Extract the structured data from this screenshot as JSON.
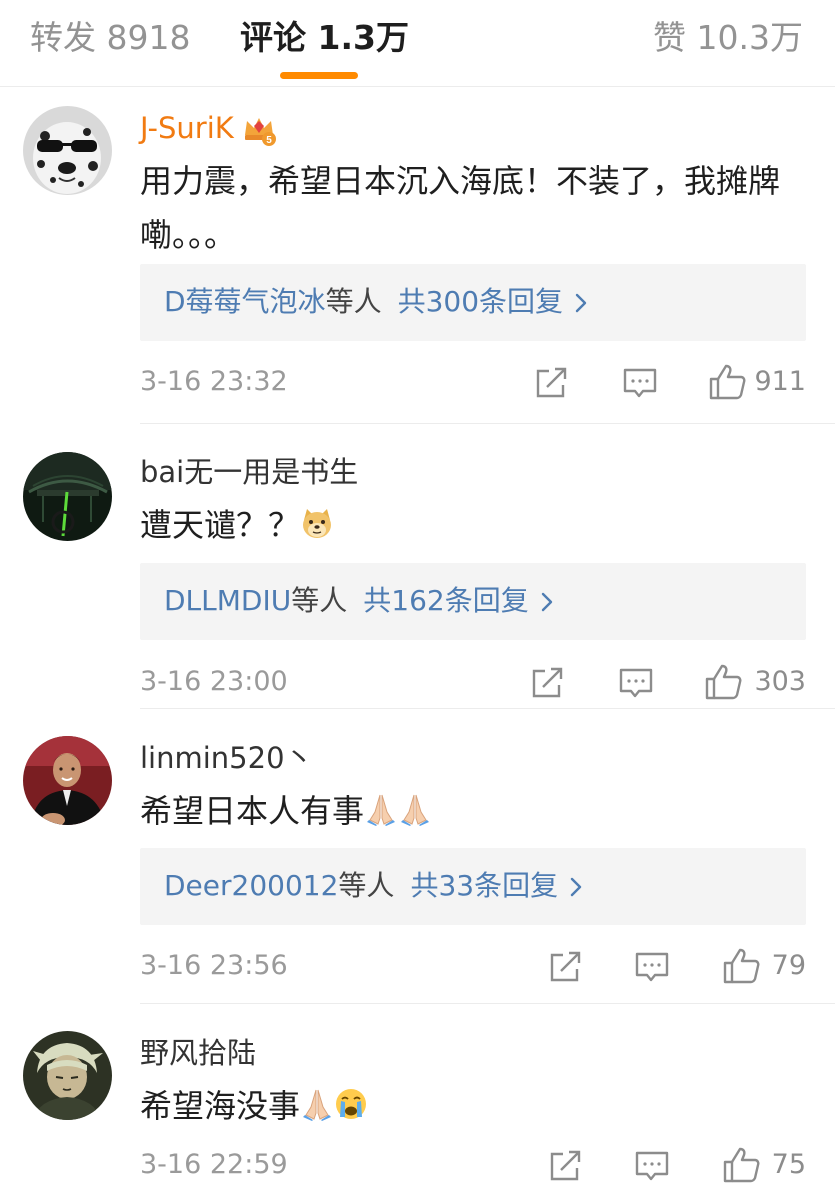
{
  "tabs": {
    "reposts": "转发 8918",
    "comments": "评论 1.3万",
    "likes": "赞 10.3万",
    "active": "comments"
  },
  "colors": {
    "accent": "#ff8a00",
    "vip_name": "#f17b12",
    "link": "#4e7cb2",
    "meta_text": "#9a9a9a",
    "reply_bg": "#f4f4f4"
  },
  "comments": [
    {
      "username": "J-SuriK",
      "vip": true,
      "vip_level": "5",
      "text": "用力震，希望日本沉入海底！不装了，我摊牌嘞。。。",
      "emojis": [],
      "reply_names": "D莓莓气泡冰",
      "reply_suffix": "等人",
      "reply_count": "共300条回复",
      "time": "3-16 23:32",
      "likes": "911"
    },
    {
      "username": "bai无一用是书生",
      "vip": false,
      "text": "遭天谴？？",
      "emojis": [
        "doge-emoji"
      ],
      "reply_names": "DLLMDIU",
      "reply_suffix": "等人",
      "reply_count": "共162条回复",
      "time": "3-16 23:00",
      "likes": "303"
    },
    {
      "username": "linmin520丶",
      "vip": false,
      "text": "希望日本人有事",
      "emojis": [
        "praying-hands-emoji",
        "praying-hands-emoji"
      ],
      "reply_names": "Deer200012",
      "reply_suffix": "等人",
      "reply_count": "共33条回复",
      "time": "3-16 23:56",
      "likes": "79"
    },
    {
      "username": "野风拾陆",
      "vip": false,
      "text": "希望海没事",
      "emojis": [
        "praying-hands-emoji",
        "crying-face-emoji"
      ],
      "time": "3-16 22:59",
      "likes": "75"
    }
  ],
  "icons": {
    "share": "share-icon",
    "comment": "comment-icon",
    "like": "thumbs-up-icon",
    "reply_more": "chevron-right-icon",
    "vip": "vip-crown-icon"
  }
}
